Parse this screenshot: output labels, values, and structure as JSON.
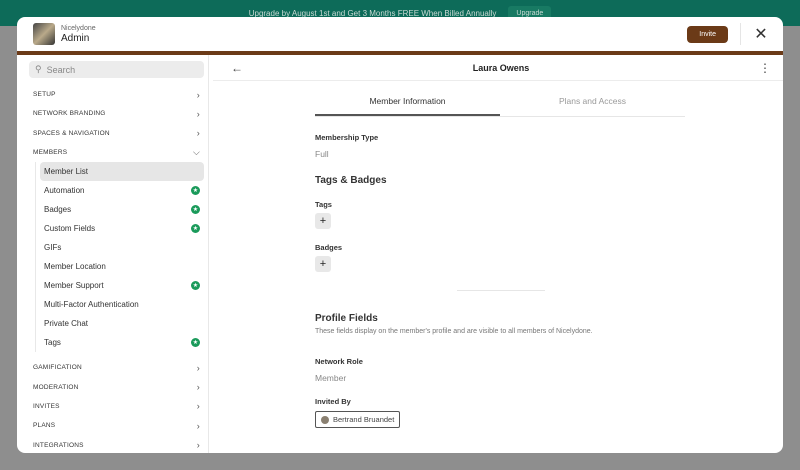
{
  "banner": {
    "text": "Upgrade by August 1st and Get 3 Months FREE When Billed Annually",
    "button": "Upgrade"
  },
  "header": {
    "network": "Nicelydone",
    "title": "Admin",
    "invite": "Invite"
  },
  "sidebar": {
    "search_placeholder": "Search",
    "sections_before": [
      {
        "label": "SETUP"
      },
      {
        "label": "NETWORK BRANDING"
      },
      {
        "label": "SPACES & NAVIGATION"
      }
    ],
    "members_label": "MEMBERS",
    "member_items": [
      {
        "label": "Member List",
        "star": false
      },
      {
        "label": "Automation",
        "star": true
      },
      {
        "label": "Badges",
        "star": true
      },
      {
        "label": "Custom Fields",
        "star": true
      },
      {
        "label": "GIFs",
        "star": false
      },
      {
        "label": "Member Location",
        "star": false
      },
      {
        "label": "Member Support",
        "star": true
      },
      {
        "label": "Multi-Factor Authentication",
        "star": false
      },
      {
        "label": "Private Chat",
        "star": false
      },
      {
        "label": "Tags",
        "star": true
      }
    ],
    "sections_after": [
      {
        "label": "GAMIFICATION"
      },
      {
        "label": "MODERATION"
      },
      {
        "label": "INVITES"
      },
      {
        "label": "PLANS"
      },
      {
        "label": "INTEGRATIONS"
      }
    ]
  },
  "main": {
    "title": "Laura Owens",
    "tabs": [
      "Member Information",
      "Plans and Access"
    ],
    "membership_type_label": "Membership Type",
    "membership_type": "Full",
    "tags_badges_heading": "Tags & Badges",
    "tags_label": "Tags",
    "badges_label": "Badges",
    "profile_heading": "Profile Fields",
    "profile_desc": "These fields display on the member's profile and are visible to all members of Nicelydone.",
    "role_label": "Network Role",
    "role": "Member",
    "invited_label": "Invited By",
    "invited_by": "Bertrand Bruandet"
  }
}
